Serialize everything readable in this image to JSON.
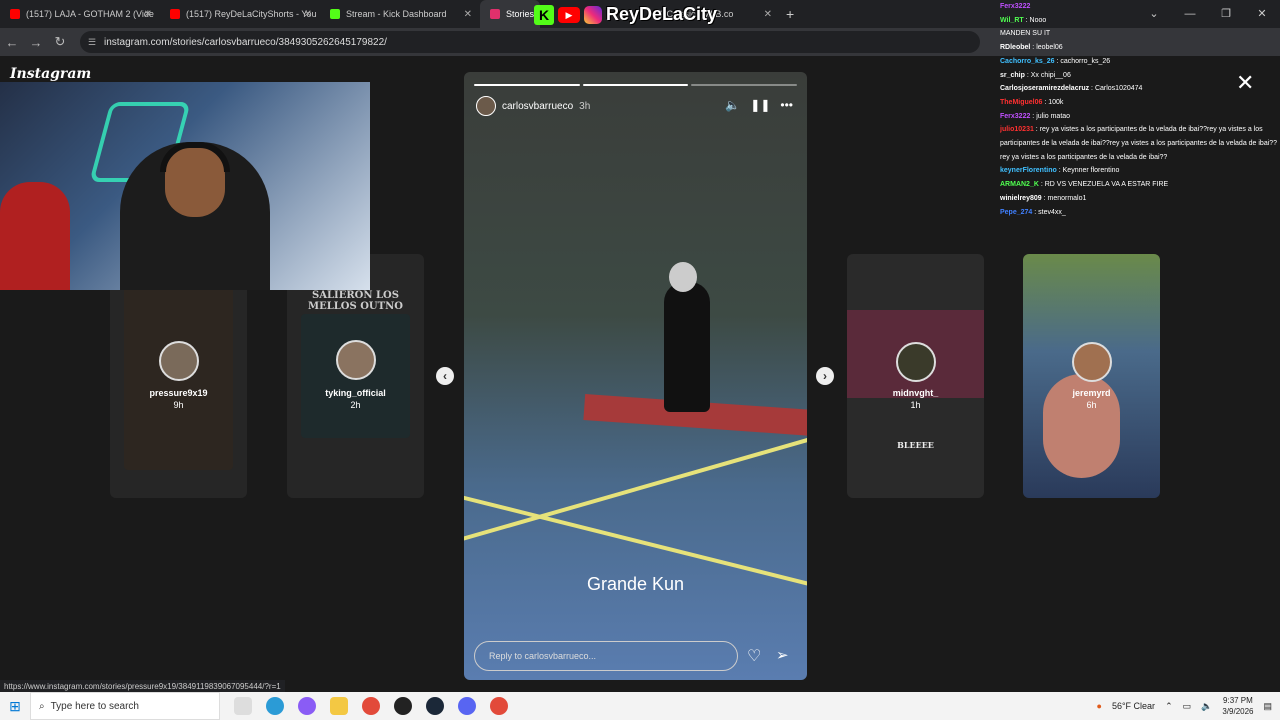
{
  "browser": {
    "tabs": [
      {
        "title": "(1517) LAJA - GOTHAM 2 (Vide",
        "icon_color": "#ff0000"
      },
      {
        "title": "(1517) ReyDeLaCityShorts - You",
        "icon_color": "#ff0000"
      },
      {
        "title": "Stream - Kick Dashboard",
        "icon_color": "#53fc18"
      },
      {
        "title": "Stories",
        "icon_color": "#e1306c"
      },
      {
        "title": "ll Classic | MLB.co",
        "icon_color": "#1a4c8c"
      }
    ],
    "url": "instagram.com/stories/carlosvbarrueco/3849305262645179822/",
    "status_url": "https://www.instagram.com/stories/pressure9x19/3849119839067095444/?r=1"
  },
  "brand": {
    "name": "ReyDeLaCity"
  },
  "instagram": {
    "logo": "Instagram",
    "story": {
      "username": "carlosvbarrueco",
      "time": "3h",
      "caption": "Grande Kun",
      "reply_placeholder": "Reply to carlosvbarrueco..."
    },
    "side_stories": [
      {
        "username": "pressure9x19",
        "time": "9h"
      },
      {
        "username": "tyking_official",
        "time": "2h",
        "text": "SALIERON LOS MELLOS OUTNO"
      },
      {
        "username": "midnvght_",
        "time": "1h",
        "text": "BLEEEE"
      },
      {
        "username": "jeremyrd",
        "time": "6h"
      }
    ]
  },
  "chat": [
    {
      "user": "Ferx3222",
      "msg": "",
      "color": "#c050ff"
    },
    {
      "user": "Wil_RT",
      "msg": "Nooo",
      "color": "#50ff50"
    },
    {
      "user": "",
      "msg": "MANDEN SU IT",
      "color": "#ff3030"
    },
    {
      "user": "RDleobel",
      "msg": "leobel06",
      "color": "#ffffff"
    },
    {
      "user": "Cachorro_ks_26",
      "msg": "cachorro_ks_26",
      "color": "#40c0ff"
    },
    {
      "user": "sr_chip",
      "msg": "Xx chipi__06",
      "color": "#ffffff"
    },
    {
      "user": "Carlosjoseramirezdelacruz",
      "msg": "Carlos1020474",
      "color": "#ffffff"
    },
    {
      "user": "TheMiguel06",
      "msg": "100k",
      "color": "#ff3030"
    },
    {
      "user": "Ferx3222",
      "msg": "julio matao",
      "color": "#c050ff"
    },
    {
      "user": "julio10231",
      "msg": "rey ya vistes a los participantes de la velada de ibai??rey ya vistes a los participantes de la velada de ibai??rey ya vistes a los participantes de la velada de ibai??rey ya vistes a los participantes de la velada de ibai??",
      "color": "#ff3030"
    },
    {
      "user": "keynerFlorentino",
      "msg": "Keynner florentino",
      "color": "#40c0ff"
    },
    {
      "user": "ARMAN2_K",
      "msg": "RD VS VENEZUELA VA A ESTAR FIRE",
      "color": "#50ff50"
    },
    {
      "user": "winielrey809",
      "msg": "menormalo1",
      "color": "#ffffff"
    },
    {
      "user": "Pepe_274",
      "msg": "stev4xx_",
      "color": "#4080ff"
    }
  ],
  "taskbar": {
    "search_placeholder": "Type here to search",
    "weather": "56°F  Clear",
    "time": "9:37 PM",
    "date": "3/9/2026"
  }
}
